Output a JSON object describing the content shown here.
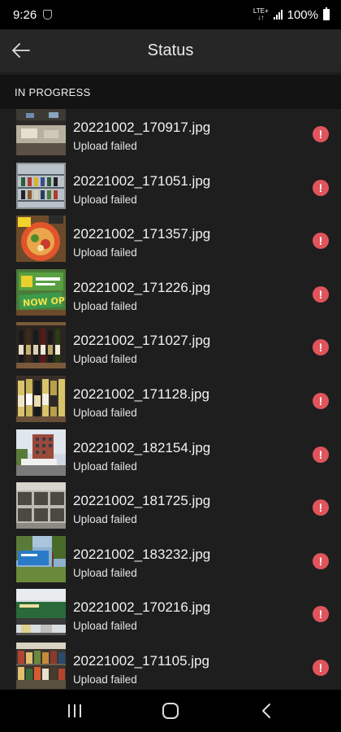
{
  "status_bar": {
    "time": "9:26",
    "network_top": "LTE+",
    "network_bottom": "↓↑",
    "battery_percent": "100%",
    "icons": [
      "nfl-icon",
      "signal-icon",
      "battery-icon"
    ]
  },
  "header": {
    "title": "Status",
    "back_icon": "arrow-left-icon"
  },
  "section": {
    "title": "IN PROGRESS"
  },
  "files": [
    {
      "name": "20221002_170917.jpg",
      "status": "Upload failed",
      "thumb": "interior"
    },
    {
      "name": "20221002_171051.jpg",
      "status": "Upload failed",
      "thumb": "fridge"
    },
    {
      "name": "20221002_171357.jpg",
      "status": "Upload failed",
      "thumb": "food"
    },
    {
      "name": "20221002_171226.jpg",
      "status": "Upload failed",
      "thumb": "sign"
    },
    {
      "name": "20221002_171027.jpg",
      "status": "Upload failed",
      "thumb": "wine"
    },
    {
      "name": "20221002_171128.jpg",
      "status": "Upload failed",
      "thumb": "wine2"
    },
    {
      "name": "20221002_182154.jpg",
      "status": "Upload failed",
      "thumb": "building"
    },
    {
      "name": "20221002_181725.jpg",
      "status": "Upload failed",
      "thumb": "storefront"
    },
    {
      "name": "20221002_183232.jpg",
      "status": "Upload failed",
      "thumb": "outdoor"
    },
    {
      "name": "20221002_170216.jpg",
      "status": "Upload failed",
      "thumb": "shop"
    },
    {
      "name": "20221002_171105.jpg",
      "status": "Upload failed",
      "thumb": "shelf"
    }
  ],
  "colors": {
    "error": "#e0545c",
    "background": "#1e1e1e",
    "header_bg": "#262626",
    "section_bg": "#131313"
  },
  "nav": {
    "icons": [
      "recent-apps-icon",
      "home-icon",
      "back-icon"
    ]
  }
}
